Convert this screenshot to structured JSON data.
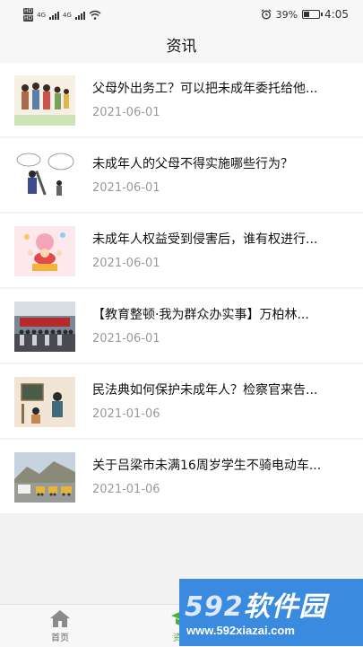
{
  "status": {
    "sim1": "HD",
    "sim2": "HD",
    "net1": "4G",
    "net2": "4G",
    "battery_pct_text": "39%",
    "battery_level": 0.39,
    "time": "4:05"
  },
  "header": {
    "title": "资讯"
  },
  "news": [
    {
      "title": "父母外出务工？可以把未成年委托给他...",
      "date": "2021-06-01",
      "thumb_icon": "family-illustration-icon"
    },
    {
      "title": "未成年人的父母不得实施哪些行为？",
      "date": "2021-06-01",
      "thumb_icon": "parent-child-illustration-icon"
    },
    {
      "title": "未成年人权益受到侵害后，谁有权进行...",
      "date": "2021-06-01",
      "thumb_icon": "children-festival-icon"
    },
    {
      "title": "【教育整顿·我为群众办实事】万柏林...",
      "date": "2021-06-01",
      "thumb_icon": "group-photo-icon"
    },
    {
      "title": "民法典如何保护未成年人？检察官来告...",
      "date": "2021-01-06",
      "thumb_icon": "classroom-illustration-icon"
    },
    {
      "title": "关于吕梁市未满16周岁学生不骑电动车...",
      "date": "2021-01-06",
      "thumb_icon": "street-photo-icon"
    }
  ],
  "tabbar": {
    "items": [
      {
        "label": "首页",
        "icon": "home-icon"
      },
      {
        "label": "资讯",
        "icon": "graduation-cap-icon"
      }
    ]
  },
  "watermark": {
    "logo_num": "592",
    "logo_text": "软件园",
    "url": "www.592xiazai.com"
  },
  "colors": {
    "accent": "#4cae3c",
    "watermark_bg": "#3a8be0"
  }
}
